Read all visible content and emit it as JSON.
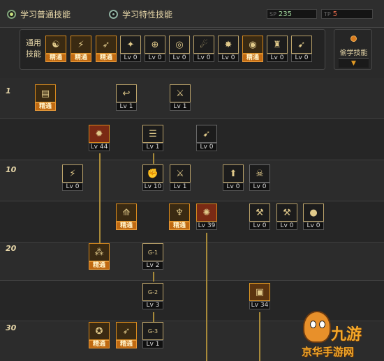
{
  "tabs": [
    {
      "label": "学习普通技能",
      "active": true
    },
    {
      "label": "学习特性技能",
      "active": false
    }
  ],
  "points": {
    "sp_label": "SP",
    "sp_value": "235",
    "tp_label": "TP",
    "tp_value": "5"
  },
  "general": {
    "label_line1": "通用",
    "label_line2": "技能",
    "skills": [
      {
        "icon": "meditation-icon",
        "glyph": "☯",
        "state": "mastered",
        "level": "精通"
      },
      {
        "icon": "kick-icon",
        "glyph": "⚡",
        "state": "mastered",
        "level": "精通"
      },
      {
        "icon": "leap-icon",
        "glyph": "➶",
        "state": "mastered",
        "level": "精通"
      },
      {
        "icon": "wings-icon",
        "glyph": "✦",
        "state": "normal",
        "level": "Lv 0"
      },
      {
        "icon": "crosshair-icon",
        "glyph": "⊕",
        "state": "normal",
        "level": "Lv 0"
      },
      {
        "icon": "target-icon",
        "glyph": "◎",
        "state": "normal",
        "level": "Lv 0"
      },
      {
        "icon": "charge-icon",
        "glyph": "☄",
        "state": "normal",
        "level": "Lv 0"
      },
      {
        "icon": "burst-icon",
        "glyph": "✸",
        "state": "normal",
        "level": "Lv 0"
      },
      {
        "icon": "shield-icon",
        "glyph": "◉",
        "state": "mastered",
        "level": "精通"
      },
      {
        "icon": "armor-icon",
        "glyph": "♜",
        "state": "normal",
        "level": "Lv 0"
      },
      {
        "icon": "sprint-icon",
        "glyph": "➹",
        "state": "normal",
        "level": "Lv 0"
      }
    ]
  },
  "steal": {
    "label": "偷学技能",
    "arrow": "▼"
  },
  "tree": {
    "row_labels": [
      "1",
      "10",
      "20",
      "30"
    ],
    "skills": [
      {
        "icon": "book-icon",
        "glyph": "▤",
        "state": "mastered",
        "level": "精通"
      },
      {
        "icon": "swing-icon",
        "glyph": "↩",
        "state": "normal",
        "level": "Lv 1"
      },
      {
        "icon": "sword-icon",
        "glyph": "⚔",
        "state": "normal",
        "level": "Lv 1"
      },
      {
        "icon": "explosion-icon",
        "glyph": "✹",
        "state": "red",
        "level": "Lv 44"
      },
      {
        "icon": "light-icon",
        "glyph": "☰",
        "state": "normal",
        "level": "Lv 1"
      },
      {
        "icon": "gun-icon",
        "glyph": "➹",
        "state": "ng",
        "level": "Lv 0"
      },
      {
        "icon": "slash-icon",
        "glyph": "⚡",
        "state": "normal",
        "level": "Lv 0"
      },
      {
        "icon": "fist-icon",
        "glyph": "✊",
        "state": "normal",
        "level": "Lv 10"
      },
      {
        "icon": "blade-icon",
        "glyph": "⚔",
        "state": "normal",
        "level": "Lv 1"
      },
      {
        "icon": "stomp-icon",
        "glyph": "⬆",
        "state": "normal",
        "level": "Lv 0"
      },
      {
        "icon": "mask-icon",
        "glyph": "☠",
        "state": "ng",
        "level": "Lv 0"
      },
      {
        "icon": "arrow-spread-icon",
        "glyph": "⟰",
        "state": "mastered",
        "level": "精通"
      },
      {
        "icon": "rage-icon",
        "glyph": "♆",
        "state": "mastered",
        "level": "精通"
      },
      {
        "icon": "fire-burst-icon",
        "glyph": "✺",
        "state": "red",
        "level": "Lv 39"
      },
      {
        "icon": "axe-icon",
        "glyph": "⚒",
        "state": "normal",
        "level": "Lv 0"
      },
      {
        "icon": "hammer-icon",
        "glyph": "⚒",
        "state": "normal",
        "level": "Lv 0"
      },
      {
        "icon": "grenade-icon",
        "glyph": "●",
        "state": "normal",
        "level": "Lv 0"
      },
      {
        "icon": "scatter-icon",
        "glyph": "⁂",
        "state": "mastered",
        "level": "精通"
      },
      {
        "icon": "g1-icon",
        "glyph": "G-1",
        "state": "normal",
        "level": "Lv 2"
      },
      {
        "icon": "g2-icon",
        "glyph": "G-2",
        "state": "normal",
        "level": "Lv 3"
      },
      {
        "icon": "turret-icon",
        "glyph": "▣",
        "state": "orange",
        "level": "Lv 34"
      },
      {
        "icon": "bomb-icon",
        "glyph": "✪",
        "state": "mastered",
        "level": "精通"
      },
      {
        "icon": "rocket-icon",
        "glyph": "➶",
        "state": "mastered",
        "level": "精通"
      },
      {
        "icon": "g3-icon",
        "glyph": "G-3",
        "state": "normal",
        "level": "Lv 1"
      }
    ]
  },
  "watermark": {
    "logo_text": "九游",
    "site_text": "京华手游网"
  }
}
